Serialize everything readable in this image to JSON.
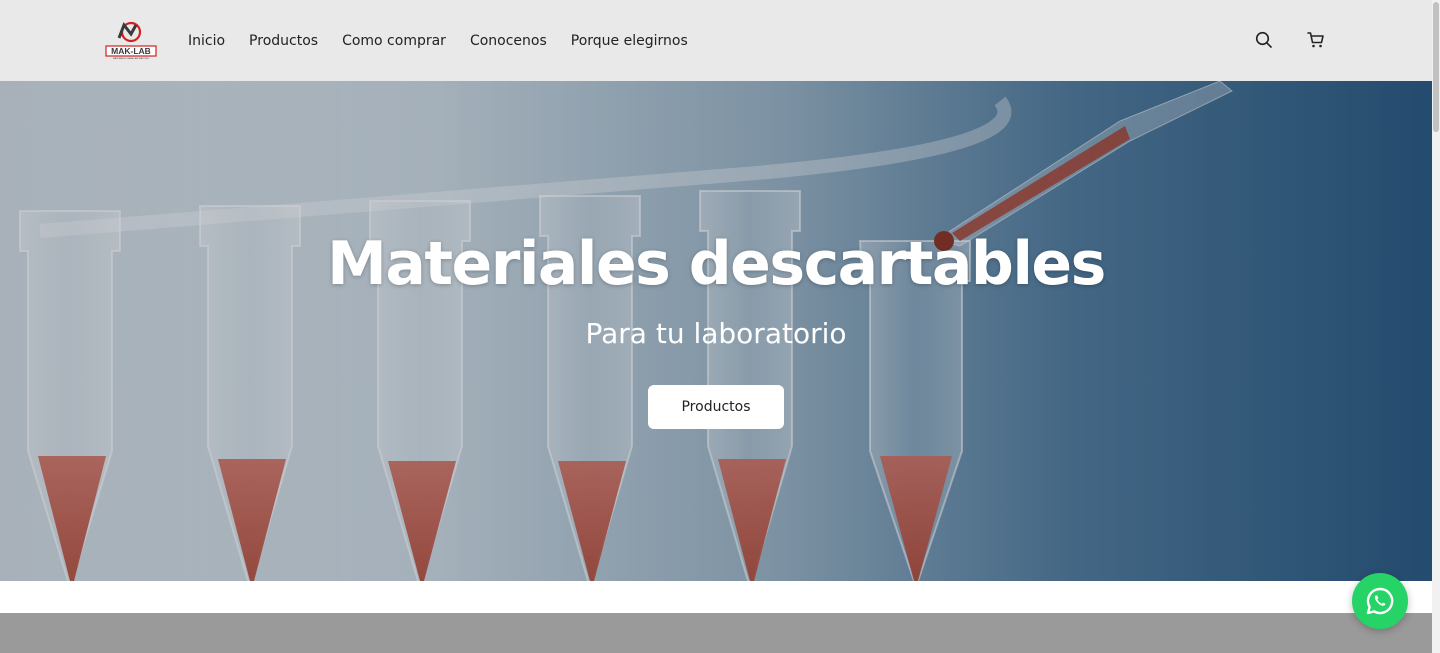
{
  "brand": {
    "logo_text": "MAK-LAB",
    "logo_tagline": "MATERIALES PARA LABORATORIO"
  },
  "nav": {
    "items": [
      {
        "label": "Inicio"
      },
      {
        "label": "Productos"
      },
      {
        "label": "Como comprar"
      },
      {
        "label": "Conocenos"
      },
      {
        "label": "Porque elegirnos"
      }
    ]
  },
  "header_icons": {
    "search": "search-icon",
    "cart": "cart-icon"
  },
  "hero": {
    "title": "Materiales descartables",
    "subtitle": "Para tu laboratorio",
    "button_label": "Productos"
  },
  "floating": {
    "whatsapp": "whatsapp-icon"
  },
  "colors": {
    "header_bg": "#e9e9e9",
    "whatsapp": "#25d366",
    "logo_red": "#d32020",
    "logo_dark": "#3a3a3a"
  }
}
